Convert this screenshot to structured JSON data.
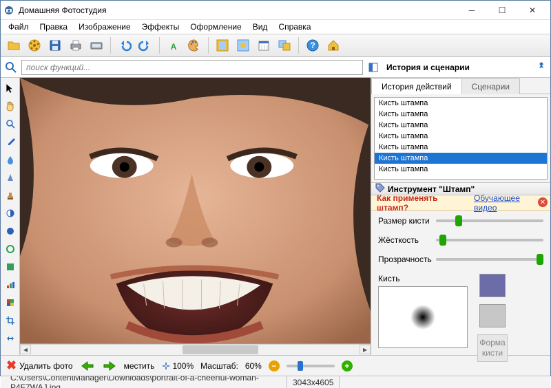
{
  "window": {
    "title": "Домашняя Фотостудия"
  },
  "menu": [
    "Файл",
    "Правка",
    "Изображение",
    "Эффекты",
    "Оформление",
    "Вид",
    "Справка"
  ],
  "search": {
    "placeholder": "поиск функций..."
  },
  "right_header": "История и сценарии",
  "tabs": {
    "history": "История действий",
    "scenarios": "Сценарии"
  },
  "history": {
    "items": [
      "Кисть штампа",
      "Кисть штампа",
      "Кисть штампа",
      "Кисть штампа",
      "Кисть штампа",
      "Кисть штампа",
      "Кисть штампа"
    ],
    "selected_index": 5
  },
  "tool_panel": {
    "title": "Инструмент \"Штамп\""
  },
  "help": {
    "question": "Как применять штамп?",
    "link": "Обучающее видео"
  },
  "props": {
    "size": {
      "label": "Размер кисти",
      "pos": 18
    },
    "hardness": {
      "label": "Жёсткость",
      "pos": 3
    },
    "opacity": {
      "label": "Прозрачность",
      "pos": 100
    },
    "brush_label": "Кисть",
    "form_label1": "Форма",
    "form_label2": "кисти"
  },
  "bottom": {
    "delete": "Удалить фото",
    "fit": "местить",
    "zoom100": "100%",
    "scale_label": "Масштаб:",
    "scale_value": "60%"
  },
  "status": {
    "path": "C:\\Users\\ContentManager\\Downloads\\portrait-of-a-cheerful-woman-P4F7WAJ.jpg",
    "dims": "3043x4605"
  }
}
